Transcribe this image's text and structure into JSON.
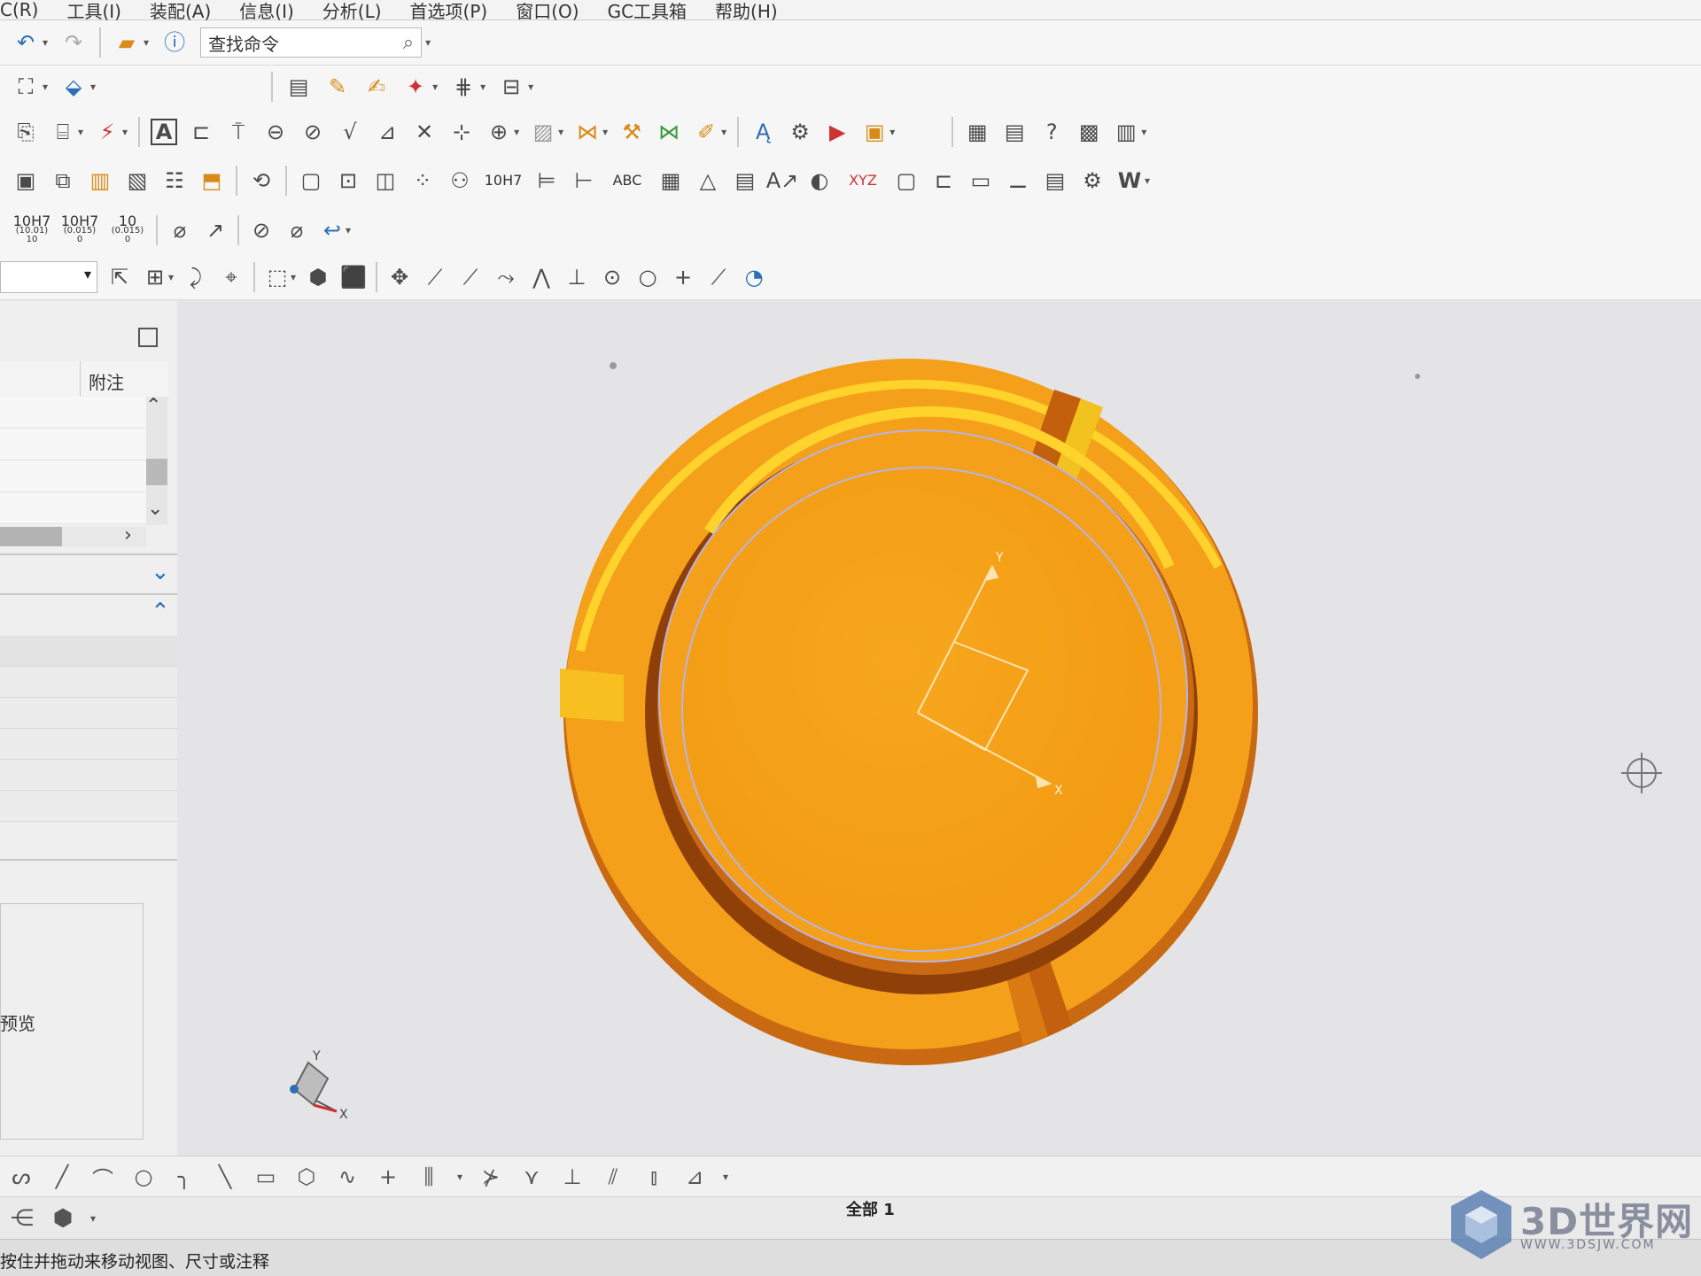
{
  "menu": {
    "items": [
      "C(R)",
      "工具(I)",
      "装配(A)",
      "信息(I)",
      "分析(L)",
      "首选项(P)",
      "窗口(O)",
      "GC工具箱",
      "帮助(H)"
    ]
  },
  "toolbar": {
    "search_value": "查找命令",
    "dim_labels": {
      "tol1": "10H7",
      "tol1_sub": "(10.01)\n10",
      "tol2": "10H7",
      "tol2_sub": "(0.015)\n0",
      "tol3": "10",
      "tol3_sub": "(0.015)\n0",
      "fit": "10H7",
      "abc": "ABC",
      "xyz": "XYZ"
    }
  },
  "panel": {
    "column_header": "附注",
    "preview_label": "预览"
  },
  "model": {
    "colors": {
      "face": "#f6a118",
      "rim_light": "#ffd029",
      "rim_dark": "#c9640e",
      "groove": "#8c3d07",
      "edge": "#b8b4e6"
    },
    "axis_labels": {
      "x": "X",
      "y": "Y"
    }
  },
  "triad": {
    "x": "X",
    "y": "Y"
  },
  "status": {
    "message": "按住并拖动来移动视图、尺寸或注释",
    "selection": "全部 1"
  },
  "watermark": {
    "brand": "3D世界网",
    "url": "WWW.3DSJW.COM"
  }
}
